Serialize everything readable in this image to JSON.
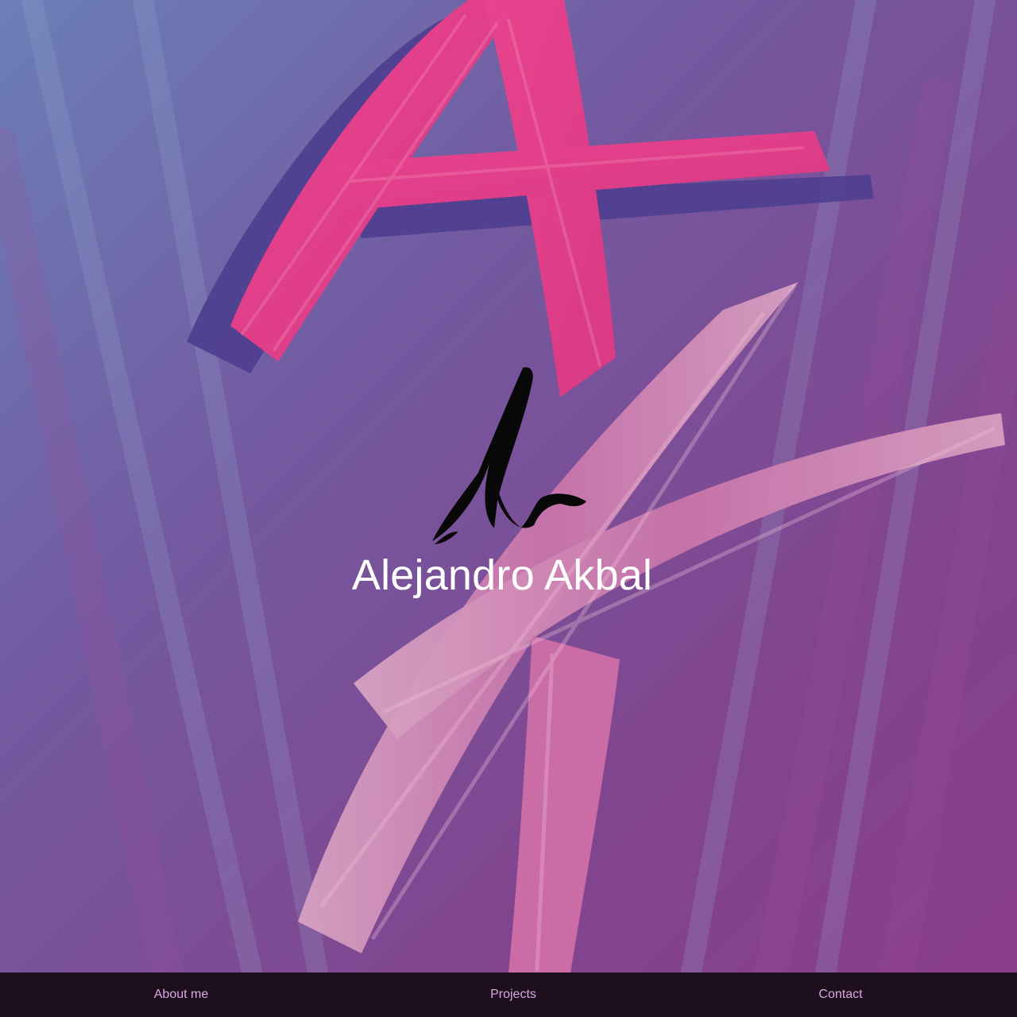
{
  "header": {
    "site_title": "Alejandro Akbal"
  },
  "nav": {
    "items": [
      {
        "label": "About me"
      },
      {
        "label": "Projects"
      },
      {
        "label": "Contact"
      }
    ]
  },
  "colors": {
    "background": "#7a4a94",
    "brush_pink": "#e23f86",
    "brush_light_pink": "#d89abb",
    "nav_background": "#1e0f1e",
    "nav_text": "#d9a9e2",
    "title_text": "#ffffff"
  },
  "icons": {
    "hero": "brush-stroke-ak-artwork",
    "logo": "calligraphy-logo-icon"
  }
}
